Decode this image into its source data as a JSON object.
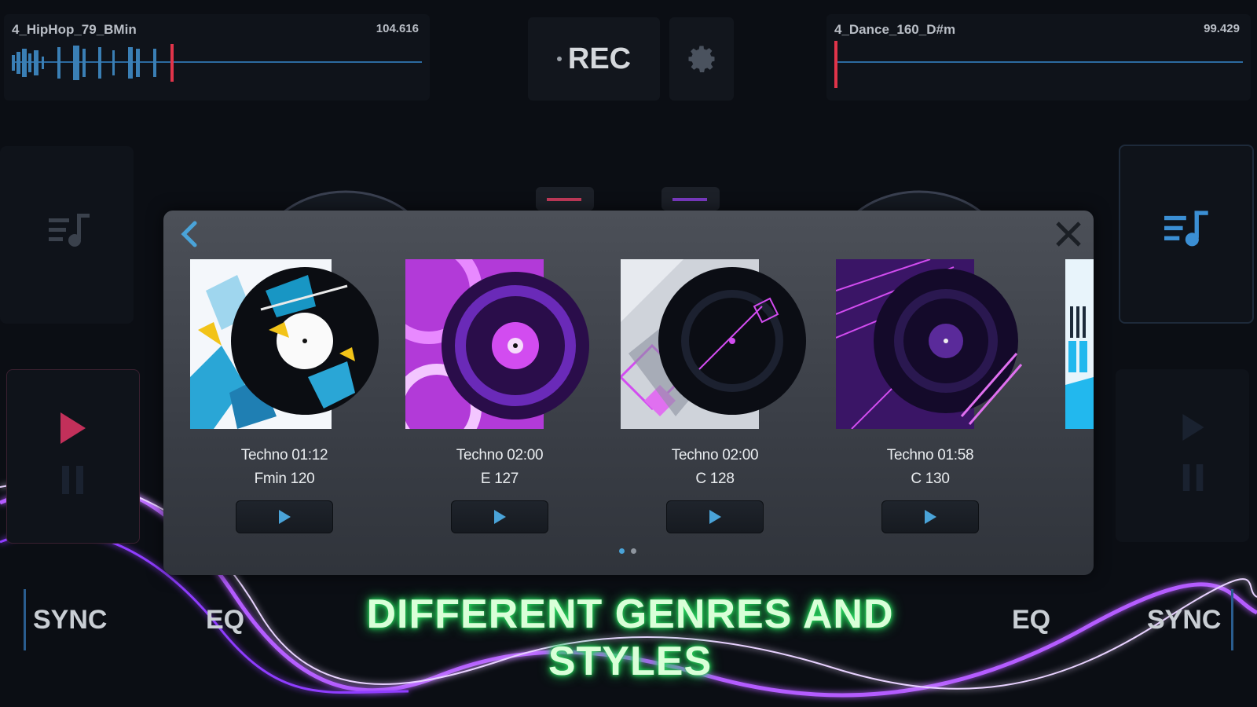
{
  "left_deck": {
    "track": "4_HipHop_79_BMin",
    "bpm": "104.616"
  },
  "right_deck": {
    "track": "4_Dance_160_D#m",
    "bpm": "99.429"
  },
  "rec": {
    "label": "REC"
  },
  "bottom": {
    "left_sync": "SYNC",
    "left_eq": "EQ",
    "right_eq": "EQ",
    "right_sync": "SYNC",
    "headline": "DIFFERENT GENRES AND STYLES"
  },
  "modal": {
    "cards": [
      {
        "title": "Techno 01:12",
        "sub": "Fmin 120"
      },
      {
        "title": "Techno 02:00",
        "sub": "E 127"
      },
      {
        "title": "Techno 02:00",
        "sub": "C 128"
      },
      {
        "title": "Techno 01:58",
        "sub": "C 130"
      }
    ],
    "page_dots": 2,
    "active_page": 1
  },
  "colors": {
    "accent_blue": "#4aa3d8",
    "rec_marker": "#e0344a",
    "headline_glow": "#2ee86a",
    "neon_purple": "#b45cff"
  },
  "icons": [
    "back-chevron-icon",
    "close-icon",
    "gear-icon",
    "playlist-icon",
    "play-icon",
    "pause-icon"
  ]
}
